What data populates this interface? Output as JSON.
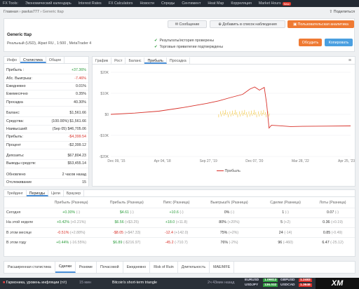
{
  "nav": {
    "items": [
      "FX Tools:",
      "Экономический календарь",
      "Interest Rates",
      "FX Calculators",
      "Новости",
      "Спреды",
      "Сентимент",
      "Heat Map",
      "Корреляция",
      "Market Hours"
    ],
    "new_badge": "New"
  },
  "breadcrumb": {
    "home": "Главная",
    "user": "pavlus777",
    "current": "Generic ttap"
  },
  "share_label": "Поделиться",
  "actions": {
    "message": "Сообщение",
    "watchlist": "Добавить в список наблюдения",
    "analytics": "Пользовательская аналитика",
    "discuss": "Обсудить",
    "copy": "Копировать"
  },
  "system": {
    "name": "Generic ttap",
    "description": "Реальный (USD), Alpari RU , 1:500 , MetaTrader 4",
    "check1": "Результаты/история проверены",
    "check2": "Торговые привилегии подтверждены"
  },
  "left_tabs": [
    "Инфо",
    "Статистика",
    "Общее"
  ],
  "stats": [
    {
      "label": "Прибыль :",
      "value": "+37.36%"
    },
    {
      "label": "Абс. Выигрыш:",
      "value": "-7.46%"
    },
    {
      "label": "Ежедневно",
      "value": "0.01%"
    },
    {
      "label": "Ежемесячно",
      "value": "0.35%"
    },
    {
      "label": "Просадка",
      "value": "40.30%"
    },
    {
      "label": "Баланс:",
      "value": "$1,561.66"
    },
    {
      "label": "Средства:",
      "value": "(100.00%) $1,561.66"
    },
    {
      "label": "Наивысший:",
      "value": "(Sep 05) $46,705.06"
    },
    {
      "label": "Прибыль:",
      "value": "-$4,399.54"
    },
    {
      "label": "Процент",
      "value": "-$2,399.12"
    },
    {
      "label": "Депозиты:",
      "value": "$67,804.23"
    },
    {
      "label": "Выводы средств:",
      "value": "$53,455.14"
    },
    {
      "label": "Обновлено",
      "value": "2 часов назад"
    },
    {
      "label": "Отслеживание",
      "value": "15"
    }
  ],
  "chart_tabs": [
    "График",
    "Рост",
    "Баланс",
    "Прибыль",
    "Просадка"
  ],
  "chart_data": {
    "type": "line",
    "title": "",
    "x_ticks": [
      "Dec 09, '15",
      "Apr 04, '18",
      "Sep 27, '19",
      "Dec 07, '20",
      "Mar 28, '22",
      "Apr 25, '23"
    ],
    "y_ticks": [
      "$20K",
      "$10K",
      "$0",
      "-$10K",
      "-$20K"
    ],
    "ylim": [
      -20000,
      20000
    ],
    "series": [
      {
        "name": "Прибыль",
        "color": "#d8312a",
        "x": [
          0,
          10,
          20,
          30,
          40,
          45,
          50,
          55,
          58,
          60,
          62,
          64,
          65,
          66,
          67,
          70,
          75,
          80,
          90,
          100
        ],
        "y": [
          0,
          600,
          1500,
          3200,
          5200,
          6400,
          8000,
          9500,
          12000,
          13000,
          11500,
          12800,
          5000,
          -6500,
          -5200,
          -5400,
          -5800,
          -5700,
          -5600,
          -5500
        ]
      }
    ],
    "bars_color": "#f0c030",
    "legend": "Прибыль"
  },
  "period_tabs": [
    "Трейдинг",
    "Периоды",
    "Цели",
    "Браузер"
  ],
  "period_headers": [
    "",
    "Прибыль (Разница)",
    "Прибыль (Разница)",
    "Пипс (Разница)",
    "Выигрыш% (Разница)",
    "Сделки (Разница)",
    "Лоты (Разница)"
  ],
  "period_rows": [
    {
      "label": "Сегодня",
      "c1": "+0.30%",
      "c1d": "(-)",
      "c2": "$4.61",
      "c2d": "(-)",
      "c3": "+10.6",
      "c3d": "(-)",
      "c4": "0%",
      "c4d": "(-)",
      "c5": "1",
      "c5d": "(-)",
      "c6": "0.07",
      "c6d": "(-)"
    },
    {
      "label": "На этой неделе",
      "c1": "+0.42%",
      "c1d": "(+0.21%)",
      "c2": "$6.56",
      "c2d": "(+$3.25)",
      "c3": "+18.0",
      "c3d": "(+11.8)",
      "c4": "80%",
      "c4d": "(+20%)",
      "c5": "5",
      "c5d": "(+2)",
      "c6": "0.36",
      "c6d": "(+0.19)"
    },
    {
      "label": "В этом месяце",
      "c1": "-0.51%",
      "c1d": "(+2.88%)",
      "c2": "-$8.05",
      "c2d": "(+$47.33)",
      "c3": "-12.4",
      "c3d": "(+142.0)",
      "c4": "75%",
      "c4d": "(+2%)",
      "c5": "24",
      "c5d": "(-14)",
      "c6": "0.85",
      "c6d": "(-0.49)"
    },
    {
      "label": "В этом году",
      "c1": "+0.44%",
      "c1d": "(-16.55%)",
      "c2": "$6.89",
      "c2d": "(-$216.97)",
      "c3": "-45.2",
      "c3d": "(-710.7)",
      "c4": "76%",
      "c4d": "(-2%)",
      "c5": "96",
      "c5d": "(-460)",
      "c6": "6.47",
      "c6d": "(-25.12)"
    }
  ],
  "bottom_tabs": [
    "Расширенная статистика",
    "Сделки",
    "Резюме",
    "Почасовой",
    "Ежедневно",
    "Risk of Ruin",
    "Длительность",
    "MAE/MFE"
  ],
  "ticker": {
    "news1": "Гармоника, уровень инфляции (т/г)",
    "news1_time": "15 мин",
    "news2": "Bitcoin's short-term triangle",
    "news2_time": "2ч 43мин назад",
    "q": [
      {
        "sym": "EURUSD",
        "bid": "1.09813",
        "sym2": "GBPUSD",
        "bid2": "1.2483"
      },
      {
        "sym": "USDJPY",
        "bid": "136.032",
        "sym2": "USDCAD",
        "bid2": "1.3646"
      }
    ],
    "brand": "XM"
  }
}
